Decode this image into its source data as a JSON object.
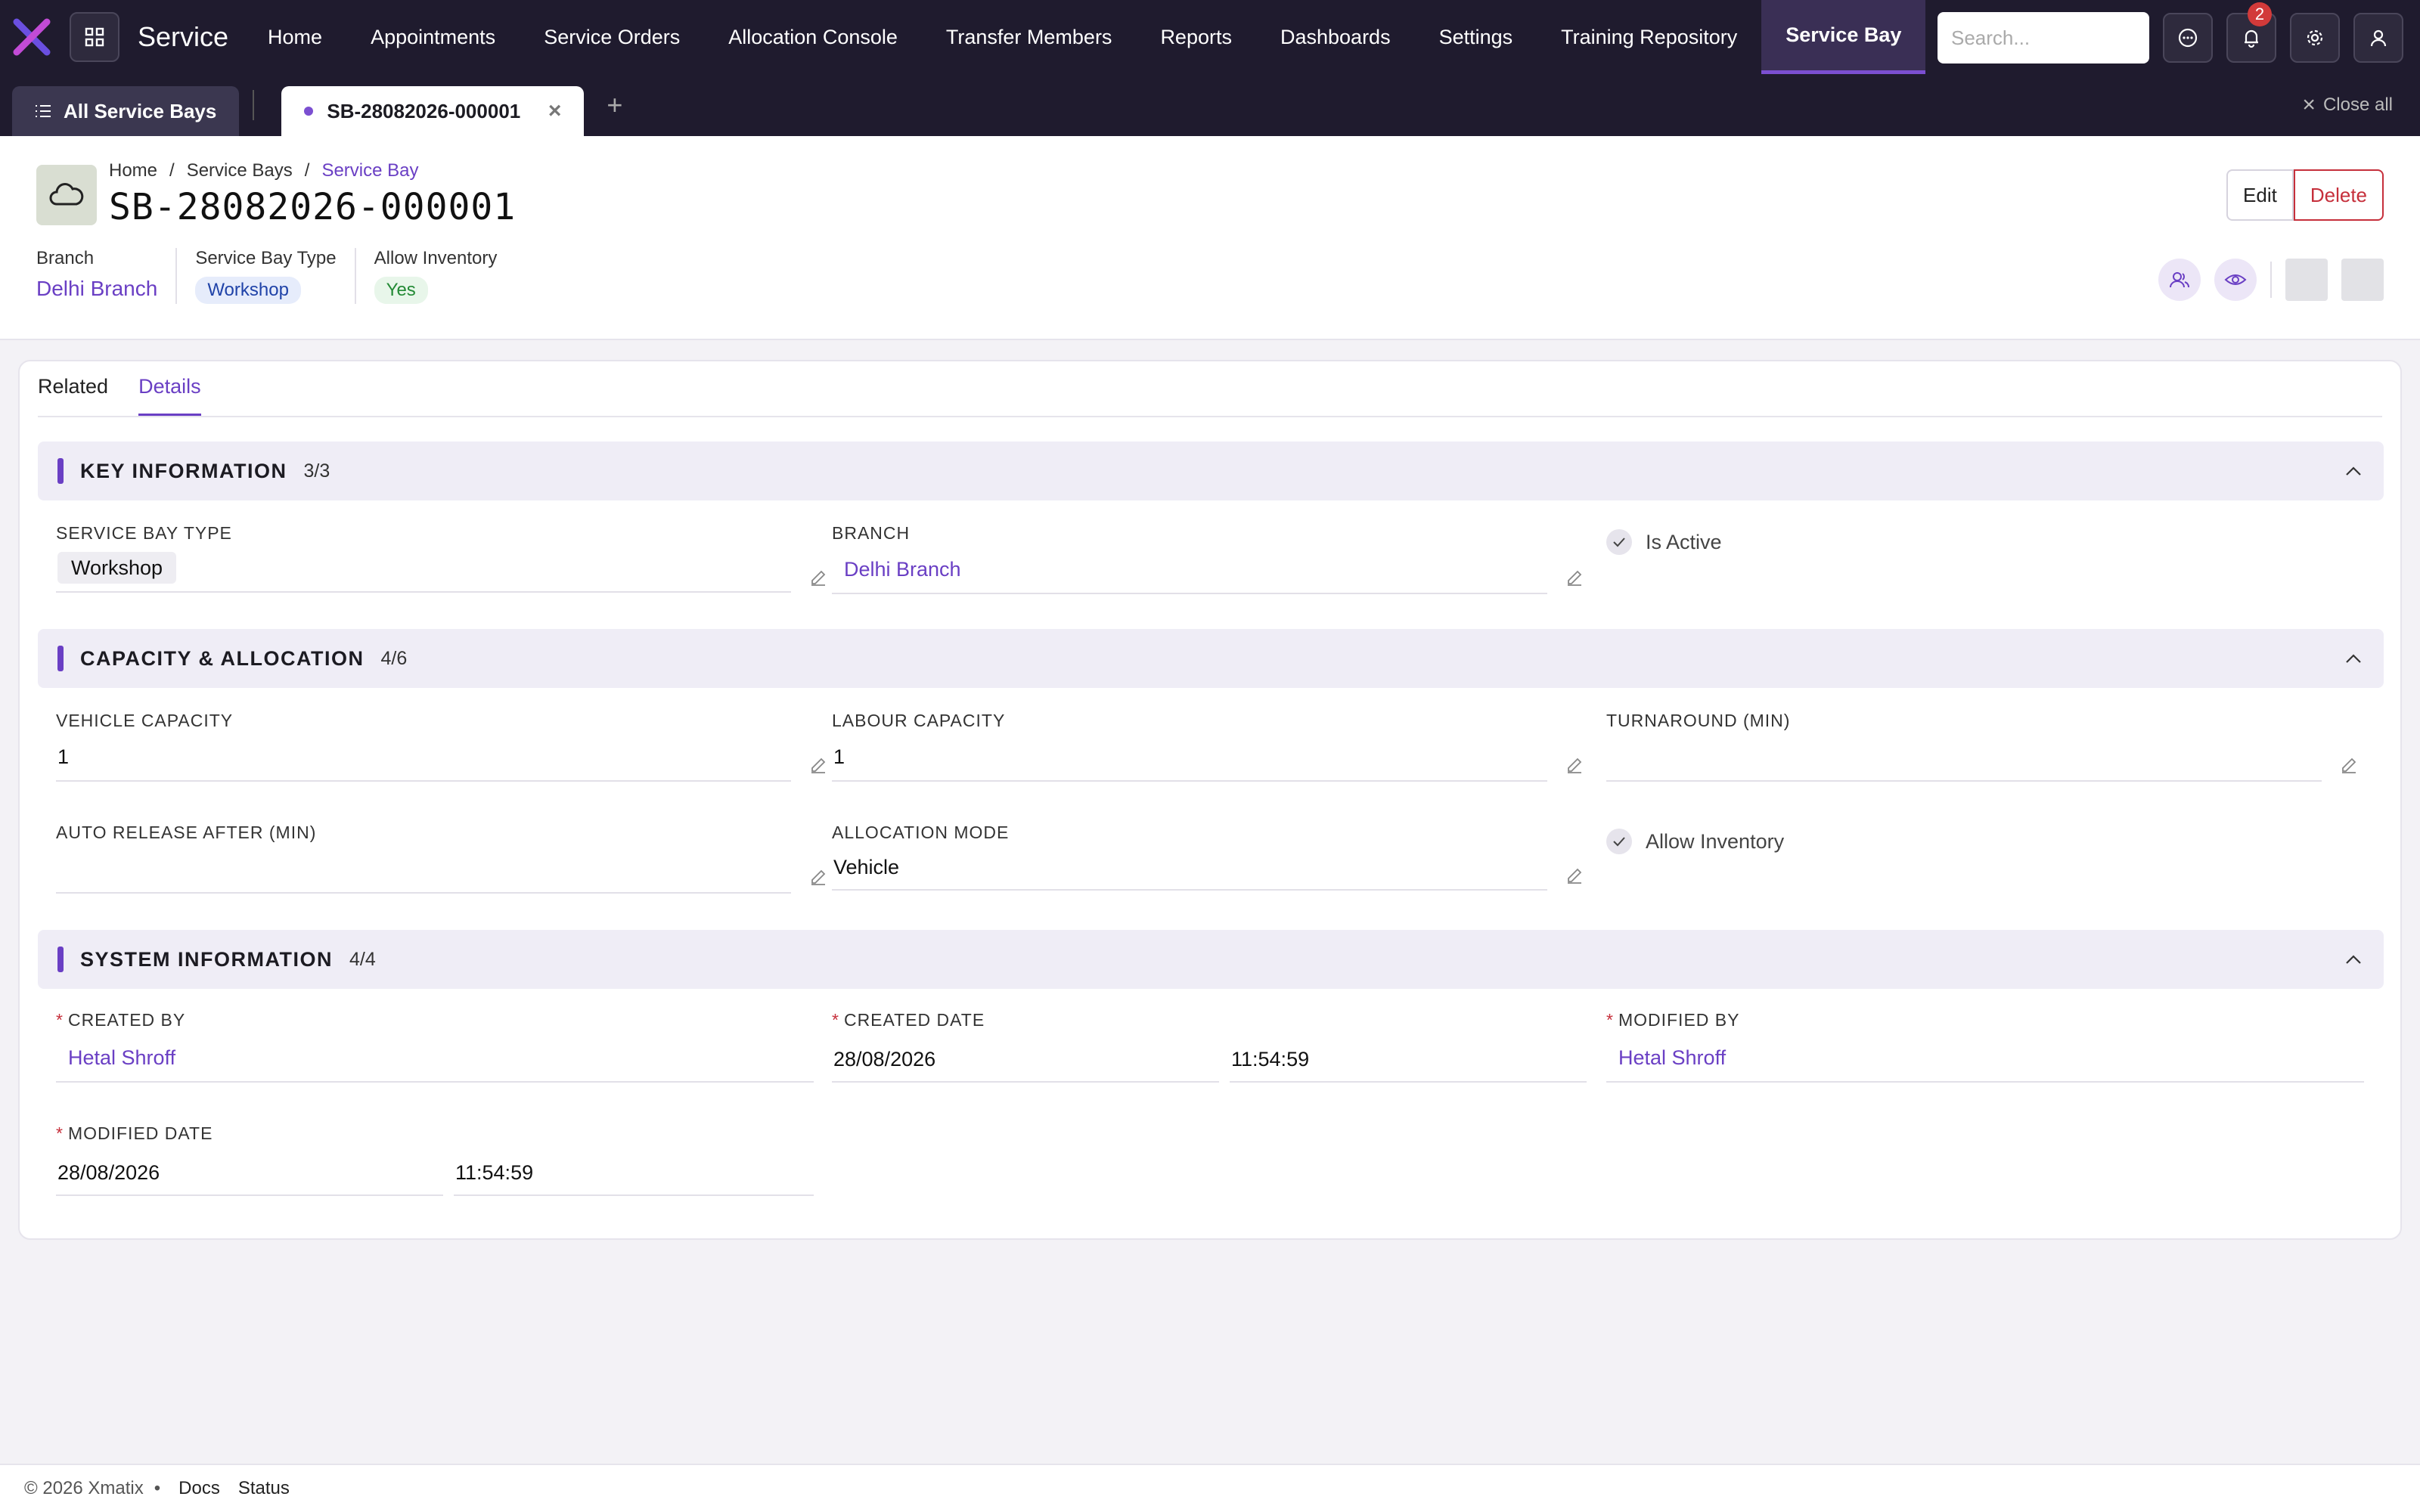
{
  "app": {
    "name": "Service"
  },
  "nav": {
    "items": [
      {
        "label": "Home"
      },
      {
        "label": "Appointments"
      },
      {
        "label": "Service Orders"
      },
      {
        "label": "Allocation Console"
      },
      {
        "label": "Transfer Members"
      },
      {
        "label": "Reports"
      },
      {
        "label": "Dashboards"
      },
      {
        "label": "Settings"
      },
      {
        "label": "Training Repository"
      },
      {
        "label": "Service Bay"
      }
    ],
    "search_placeholder": "Search...",
    "notification_count": "2"
  },
  "tabs": {
    "list_tab": "All Service Bays",
    "record_tab": "SB-28082026-000001",
    "close_all": "Close all"
  },
  "header": {
    "breadcrumb": [
      "Home",
      "Service Bays",
      "Service Bay"
    ],
    "title": "SB-28082026-000001",
    "meta": {
      "branch_label": "Branch",
      "branch_value": "Delhi Branch",
      "type_label": "Service Bay Type",
      "type_value": "Workshop",
      "inventory_label": "Allow Inventory",
      "inventory_value": "Yes"
    },
    "edit_label": "Edit",
    "delete_label": "Delete"
  },
  "content_tabs": [
    "Related",
    "Details"
  ],
  "sections": {
    "key": {
      "title": "KEY INFORMATION",
      "count": "3/3",
      "service_bay_type_label": "SERVICE BAY TYPE",
      "service_bay_type": "Workshop",
      "branch_label": "BRANCH",
      "branch": "Delhi Branch",
      "is_active_label": "Is Active"
    },
    "capacity": {
      "title": "CAPACITY & ALLOCATION",
      "count": "4/6",
      "vehicle_capacity_label": "VEHICLE CAPACITY",
      "vehicle_capacity": "1",
      "labour_capacity_label": "LABOUR CAPACITY",
      "labour_capacity": "1",
      "turnaround_label": "TURNAROUND (MIN)",
      "turnaround": "",
      "auto_release_label": "AUTO RELEASE AFTER (MIN)",
      "auto_release": "",
      "allocation_mode_label": "ALLOCATION MODE",
      "allocation_mode": "Vehicle",
      "allow_inventory_label": "Allow Inventory"
    },
    "system": {
      "title": "SYSTEM INFORMATION",
      "count": "4/4",
      "created_by_label": "CREATED BY",
      "created_by": "Hetal Shroff",
      "created_date_label": "CREATED DATE",
      "created_date": "28/08/2026",
      "created_time": "11:54:59",
      "modified_by_label": "MODIFIED BY",
      "modified_by": "Hetal Shroff",
      "modified_date_label": "MODIFIED DATE",
      "modified_date": "28/08/2026",
      "modified_time": "11:54:59"
    }
  },
  "footer": {
    "copyright": "© 2026 Xmatix",
    "bullet": "•",
    "docs": "Docs",
    "status": "Status"
  }
}
